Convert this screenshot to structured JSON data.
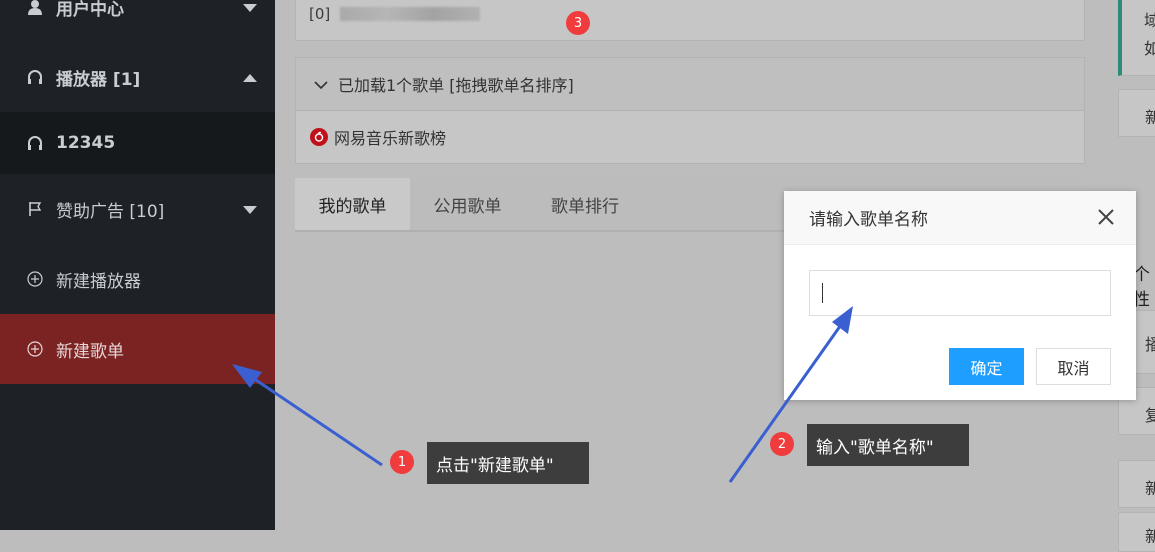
{
  "sidebar": {
    "items": [
      {
        "label": "用户中心",
        "icon": "user-icon"
      },
      {
        "label": "播放器 [1]",
        "icon": "headphones-icon"
      },
      {
        "label": "12345",
        "icon": "headphones-icon"
      },
      {
        "label": "赞助广告 [10]",
        "icon": "flag-icon"
      },
      {
        "label": "新建播放器",
        "icon": "plus-circle-icon"
      },
      {
        "label": "新建歌单",
        "icon": "plus-circle-icon"
      }
    ]
  },
  "main": {
    "top_panel_text": "[0]",
    "playlist_panel": {
      "header": "已加载1个歌单 [拖拽歌单名排序]",
      "playlists": [
        "网易音乐新歌榜"
      ]
    },
    "tabs": [
      "我的歌单",
      "公用歌单",
      "歌单排行"
    ]
  },
  "right_column": {
    "fragments": [
      "域",
      "如",
      "新",
      "个性",
      "播",
      "复",
      "新",
      "新"
    ]
  },
  "modal": {
    "title": "请输入歌单名称",
    "input_value": "",
    "confirm_label": "确定",
    "cancel_label": "取消"
  },
  "annotations": {
    "step1_number": "1",
    "step1_text": "点击\"新建歌单\"",
    "step2_number": "2",
    "step2_text": "输入\"歌单名称\"",
    "step3_number": "3"
  },
  "colors": {
    "sidebar_bg": "#1e2227",
    "active_item_bg": "#7b2323",
    "confirm_button": "#1e9fff",
    "badge": "#f03c3c",
    "arrow": "#3a5fd0",
    "netease_red": "#c0111b"
  }
}
